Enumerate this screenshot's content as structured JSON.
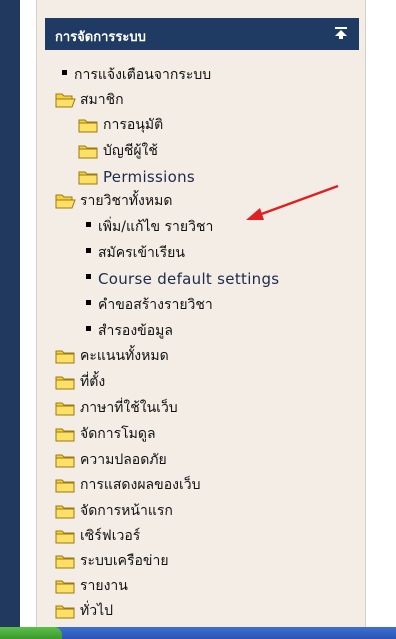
{
  "block": {
    "title": "การจัดการระบบ",
    "collapse_icon": "collapse-up-icon"
  },
  "tree": {
    "notifications": "การแจ้งเตือนจากระบบ",
    "users": {
      "label": "สมาชิก",
      "children": [
        "การอนุมัติ",
        "บัญชีผู้ใช้",
        "Permissions"
      ]
    },
    "courses": {
      "label": "รายวิชาทั้งหมด",
      "children": [
        "เพิ่ม/แก้ไข รายวิชา",
        "สมัครเข้าเรียน",
        "Course default settings",
        "คำขอสร้างรายวิชา",
        "สำรองข้อมูล"
      ]
    },
    "folders": [
      "คะแนนทั้งหมด",
      "ที่ตั้ง",
      "ภาษาที่ใช้ในเว็บ",
      "จัดการโมดูล",
      "ความปลอดภัย",
      "การแสดงผลของเว็บ",
      "จัดการหน้าแรก",
      "เซิร์ฟเวอร์",
      "ระบบเครือข่าย",
      "รายงาน",
      "ทั่วไป"
    ]
  },
  "colors": {
    "header": "#1f3b63",
    "panel": "#f3ede6",
    "folder": "#f5d03a",
    "arrow": "#e02020"
  }
}
